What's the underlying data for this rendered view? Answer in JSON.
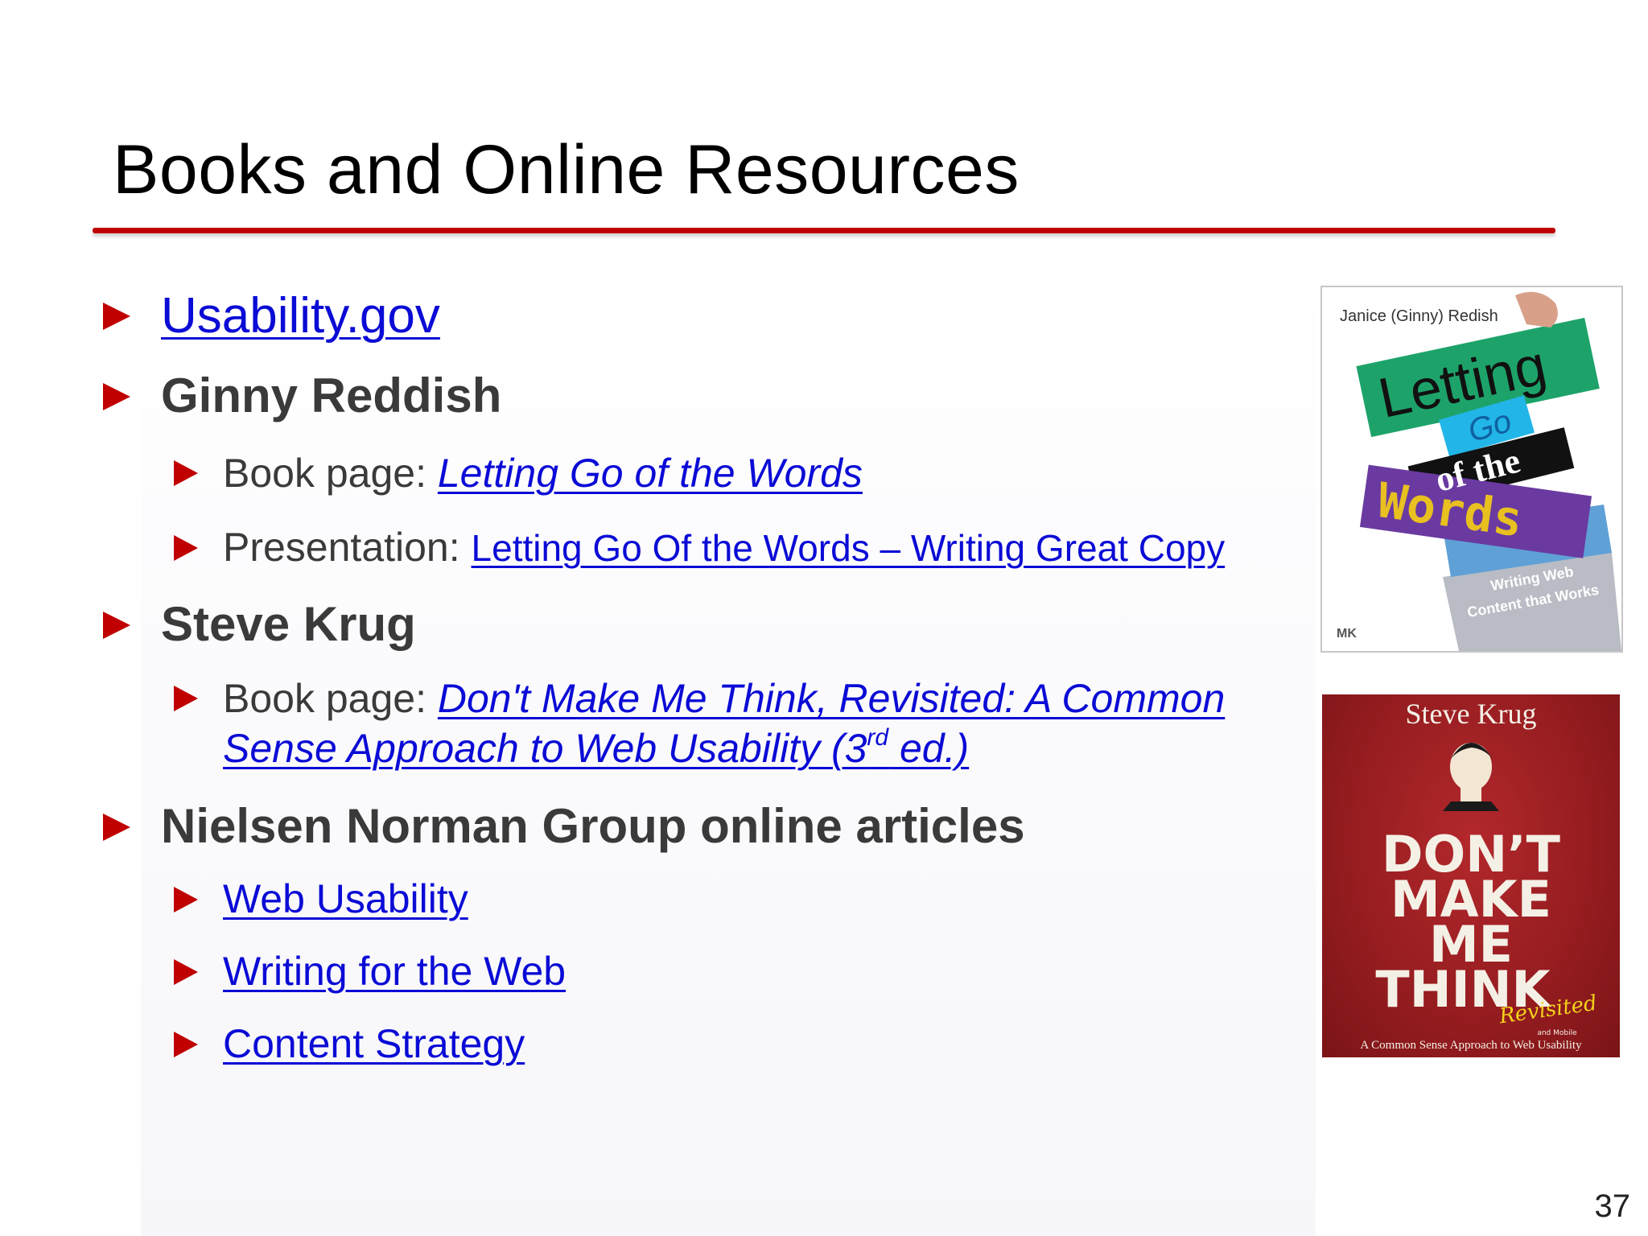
{
  "slide": {
    "title": "Books and Online Resources",
    "page_number": "37"
  },
  "bullets": {
    "usability_gov": "Usability.gov",
    "ginny": {
      "heading": "Ginny Reddish",
      "book_prefix": "Book page: ",
      "book_link": "Letting Go of the Words",
      "presentation_prefix": "Presentation: ",
      "presentation_link": "Letting Go Of the Words – Writing Great Copy"
    },
    "krug": {
      "heading": "Steve Krug",
      "book_prefix": "Book page: ",
      "book_link_line1": "Don't Make Me Think, Revisited: A Common",
      "book_link_line2": "Sense Approach to Web Usability (3",
      "book_link_sup": "rd",
      "book_link_tail": " ed.)"
    },
    "nng": {
      "heading": "Nielsen Norman Group online articles",
      "links": [
        "Web Usability",
        "Writing for the Web",
        "Content Strategy"
      ]
    }
  },
  "covers": {
    "letting_go": {
      "author": "Janice (Ginny) Redish",
      "w1": "Letting",
      "w2": "Go",
      "w3": "of the",
      "w4": "Words",
      "subtitle1": "Writing Web",
      "subtitle2": "Content that Works",
      "publisher": "MK"
    },
    "dont_make_me_think": {
      "author": "Steve Krug",
      "t1": "DON’T",
      "t2": "MAKE",
      "t3": "ME",
      "t4": "THINK",
      "revisited": "Revisited",
      "and_mobile": "and Mobile",
      "subtitle": "A Common Sense Approach to Web Usability"
    }
  },
  "colors": {
    "accent": "#c00000",
    "link": "#0b0bd6",
    "text": "#3a3a3a"
  }
}
